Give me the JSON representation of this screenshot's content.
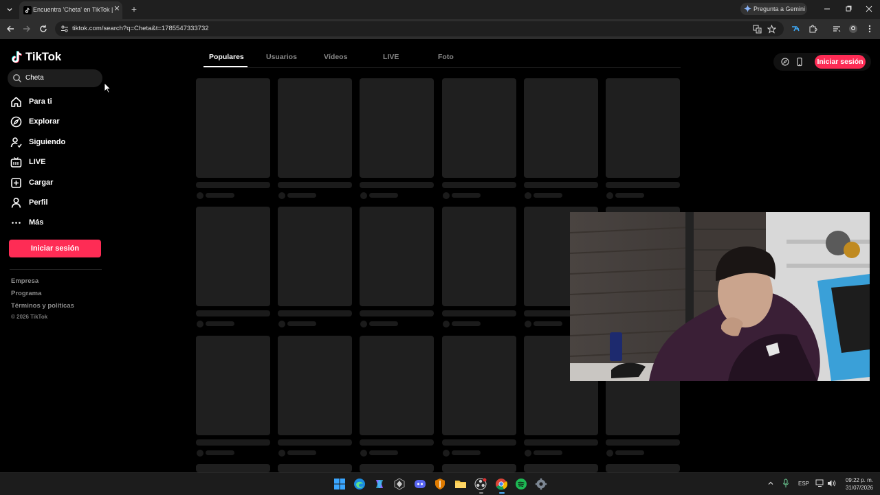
{
  "browser": {
    "tab_title": "Encuentra 'Cheta' en TikTok | B…",
    "tab_close": "✕",
    "new_tab": "+",
    "gemini_label": "Pregunta a Gemini",
    "url": "tiktok.com/search?q=Cheta&t=1785547333732"
  },
  "sidebar": {
    "logo_text": "TikTok",
    "search_value": "Cheta",
    "nav": [
      {
        "label": "Para ti",
        "icon": "home-icon"
      },
      {
        "label": "Explorar",
        "icon": "compass-icon"
      },
      {
        "label": "Siguiendo",
        "icon": "following-icon"
      },
      {
        "label": "LIVE",
        "icon": "live-icon"
      },
      {
        "label": "Cargar",
        "icon": "upload-icon"
      },
      {
        "label": "Perfil",
        "icon": "profile-icon"
      },
      {
        "label": "Más",
        "icon": "more-icon"
      }
    ],
    "login_label": "Iniciar sesión",
    "footer": [
      "Empresa",
      "Programa",
      "Términos y políticas"
    ],
    "copyright": "© 2026 TikTok"
  },
  "main": {
    "tabs": [
      "Populares",
      "Usuarios",
      "Vídeos",
      "LIVE",
      "Foto"
    ],
    "active_tab": "Populares",
    "login_label": "Iniciar sesión"
  },
  "taskbar": {
    "language": "ESP",
    "time": "09:22 p. m.",
    "date": "31/07/2026"
  },
  "colors": {
    "accent": "#fe2c55",
    "skeleton": "#1f1f1f"
  }
}
